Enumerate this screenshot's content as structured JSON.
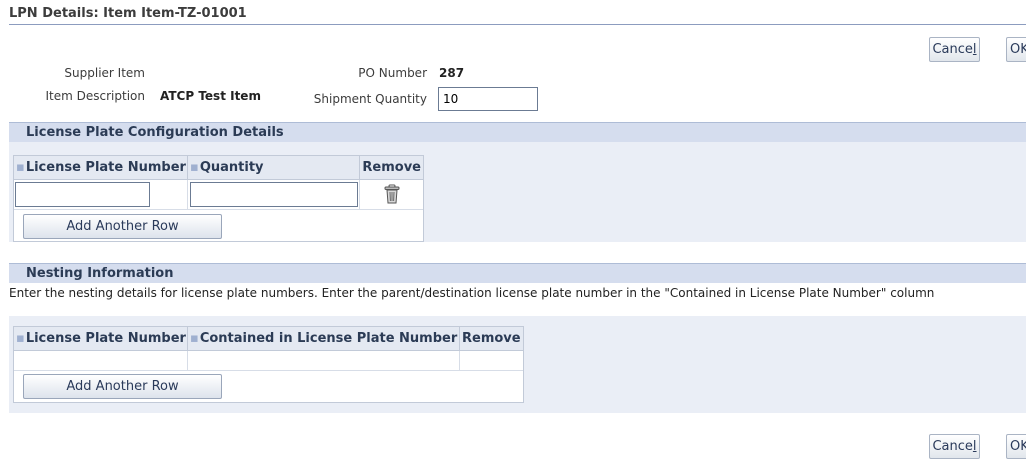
{
  "page": {
    "title": "LPN Details: Item Item-TZ-01001"
  },
  "actions": {
    "cancel_prefix": "Cance",
    "cancel_underlined": "l",
    "ok_label": "OK"
  },
  "item_info": {
    "supplier_item_label": "Supplier Item",
    "supplier_item_value": "",
    "item_description_label": "Item Description",
    "item_description_value": "ATCP Test Item",
    "po_number_label": "PO Number",
    "po_number_value": "287",
    "shipment_quantity_label": "Shipment Quantity",
    "shipment_quantity_value": "10"
  },
  "license_plate_section": {
    "title": "License Plate Configuration Details",
    "columns": [
      "License Plate Number",
      "Quantity",
      "Remove"
    ],
    "row": {
      "license_plate_number": "",
      "quantity": ""
    },
    "add_row_label": "Add Another Row",
    "remove_icon": "trash-icon"
  },
  "nesting_section": {
    "title": "Nesting Information",
    "instruction": "Enter the nesting details for license plate numbers. Enter the parent/destination license plate number in the \"Contained in License Plate Number\" column",
    "columns": [
      "License Plate Number",
      "Contained in License Plate Number",
      "Remove"
    ],
    "add_row_label": "Add Another Row"
  },
  "colors": {
    "section_header_bg": "#d5ddee",
    "section_body_bg": "#eaeef6",
    "title_rule": "#8c9cbf"
  }
}
